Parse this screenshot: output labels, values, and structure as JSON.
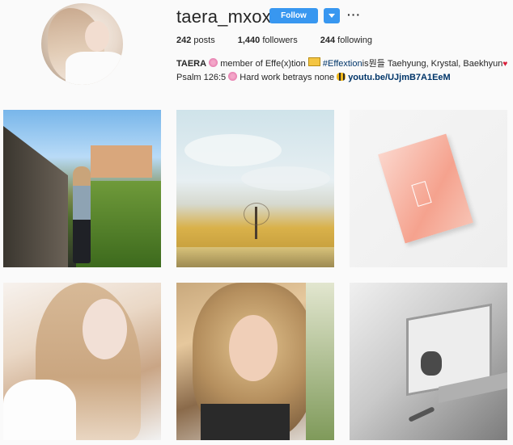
{
  "profile": {
    "username": "taera_mxox",
    "follow_label": "Follow",
    "more_label": "···"
  },
  "stats": {
    "posts": "242",
    "posts_label": "posts",
    "followers": "1,440",
    "followers_label": "followers",
    "following": "244",
    "following_label": "following"
  },
  "bio": {
    "name": "TAERA",
    "line1_a": "member of Effe(x)tion",
    "hashtag": "#Effextion",
    "line1_b": "is뭔들 Taehyung, Krystal, Baekhyun",
    "line2_a": "Psalm 126:5",
    "line2_b": "Hard work betrays none",
    "link": "youtu.be/UJjmB7A1EeM"
  },
  "icons": {
    "flower": "cherry-blossom-icon",
    "ticket": "ticket-icon",
    "heart": "heart-icon",
    "bee": "bee-icon"
  },
  "colors": {
    "accent": "#3897f0",
    "link": "#003569",
    "background": "#fafafa"
  },
  "posts": [
    {
      "name": "post-girl-on-path"
    },
    {
      "name": "post-tree-in-field"
    },
    {
      "name": "post-peach-album-cover"
    },
    {
      "name": "post-selfie-blonde-hair"
    },
    {
      "name": "post-selfie-curly-hair"
    },
    {
      "name": "post-mirror-reflection-bw"
    }
  ]
}
